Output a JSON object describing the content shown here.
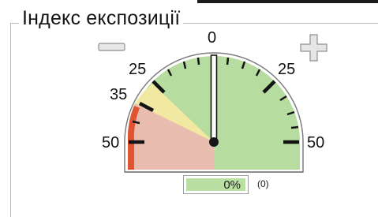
{
  "panel": {
    "title": "Індекс експозиції"
  },
  "gauge": {
    "scale_labels": {
      "center": "0",
      "left_25": "25",
      "left_35": "35",
      "left_50": "50",
      "right_25": "25",
      "right_50": "50"
    },
    "needle_value": 0,
    "readout": "0%",
    "count": "(0)"
  },
  "controls": {
    "zoom_out_icon": "minus-icon",
    "zoom_in_icon": "plus-icon"
  },
  "colors": {
    "green_zone": "#b6dc9f",
    "yellow_zone": "#f1e8a2",
    "pink_zone": "#e9bcb0",
    "red_zone": "#e05432",
    "needle": "#171717",
    "icon_gray": "#9a9a9a"
  }
}
